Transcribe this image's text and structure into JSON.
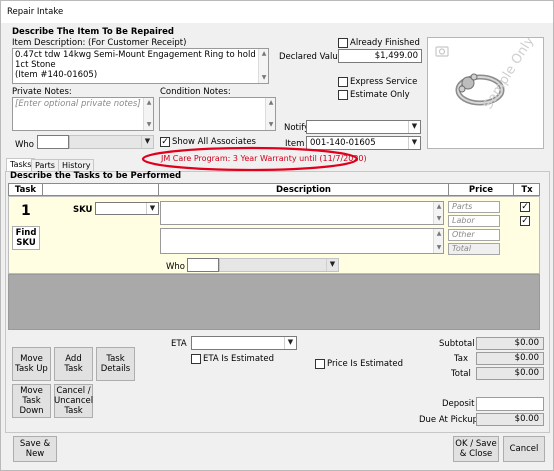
{
  "window": {
    "title": "Repair Intake"
  },
  "item": {
    "section_title": "Describe The Item To Be Repaired",
    "description_label": "Item Description: (For Customer Receipt)",
    "description_line1": "0.47ct tdw 14kwg Semi-Mount Engagement Ring to hold 1ct Stone",
    "description_line2": "(Item #140-01605)",
    "private_notes_label": "Private Notes:",
    "private_notes_placeholder": "[Enter optional private notes]",
    "condition_notes_label": "Condition Notes:",
    "who_label": "Who",
    "show_all_associates_label": "Show All Associates",
    "show_all_associates_checked": true,
    "already_finished_label": "Already Finished",
    "declared_value_label": "Declared Value",
    "declared_value": "$1,499.00",
    "express_service_label": "Express Service",
    "estimate_only_label": "Estimate Only",
    "notify_label": "Notify",
    "item_number_label": "Item #",
    "item_number": "001-140-01605",
    "jm_care_text": "JM Care Program: 3 Year Warranty until (11/7/2020)",
    "photo_watermark": "Sample Only",
    "photo_icon": "camera-icon"
  },
  "tabs": [
    {
      "label": "Tasks",
      "active": true
    },
    {
      "label": "Parts",
      "active": false
    },
    {
      "label": "History",
      "active": false
    }
  ],
  "tasks": {
    "section_title": "Describe the Tasks to be Performed",
    "columns": {
      "task": "Task",
      "description": "Description",
      "price": "Price",
      "tx": "Tx"
    },
    "row": {
      "number": "1",
      "sku_label": "SKU",
      "find_sku_label": "Find SKU",
      "who_label": "Who",
      "parts_placeholder": "Parts",
      "labor_placeholder": "Labor",
      "other_placeholder": "Other",
      "total_placeholder": "Total",
      "parts_tx_checked": true,
      "labor_tx_checked": true
    }
  },
  "bottom": {
    "eta_label": "ETA",
    "eta_is_estimated_label": "ETA Is Estimated",
    "price_is_estimated_label": "Price Is Estimated",
    "buttons": {
      "move_up": "Move Task Up",
      "add_task": "Add Task",
      "task_details": "Task Details",
      "move_down": "Move Task Down",
      "cancel_task": "Cancel / Uncancel Task"
    },
    "subtotal_label": "Subtotal",
    "subtotal": "$0.00",
    "tax_label": "Tax",
    "tax": "$0.00",
    "total_label": "Total",
    "total": "$0.00",
    "deposit_label": "Deposit",
    "deposit": "",
    "due_label": "Due At Pickup",
    "due": "$0.00"
  },
  "footer": {
    "save_new": "Save & New",
    "ok_save_close": "OK / Save & Close",
    "cancel": "Cancel"
  },
  "colors": {
    "highlight_ellipse": "#e0001b",
    "task_row_bg": "#fffde2",
    "gray_area": "#a9a9a9"
  }
}
